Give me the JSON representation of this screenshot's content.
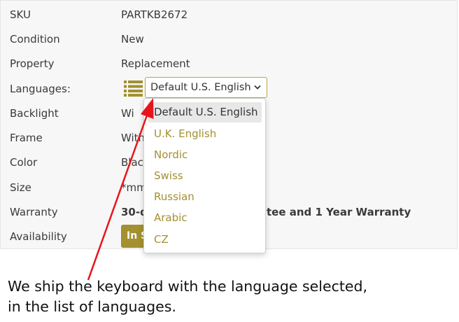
{
  "specs": [
    {
      "label": "SKU",
      "value": "PARTKB2672"
    },
    {
      "label": "Condition",
      "value": "New"
    },
    {
      "label": "Property",
      "value": "Replacement"
    },
    {
      "label": "Languages:",
      "value": ""
    },
    {
      "label": "Backlight",
      "value": "Wi"
    },
    {
      "label": "Frame",
      "value": "With"
    },
    {
      "label": "Color",
      "value": "Blac"
    },
    {
      "label": "Size",
      "value": "*mm"
    },
    {
      "label": "Warranty",
      "value_left": "30-d",
      "value_right": "tee and 1 Year Warranty"
    },
    {
      "label": "Availability",
      "badge": "In S"
    }
  ],
  "language_select": {
    "selected": "Default U.S. English",
    "icon": "list-icon",
    "options": [
      "Default U.S. English",
      "U.K. English",
      "Nordic",
      "Swiss",
      "Russian",
      "Arabic",
      "CZ"
    ]
  },
  "caption": {
    "line1": "We ship the keyboard with the language selected,",
    "line2": "in the list of languages."
  },
  "colors": {
    "accent": "#a39030",
    "arrow": "#e8141c",
    "selected_bg": "#e8e8e8"
  }
}
